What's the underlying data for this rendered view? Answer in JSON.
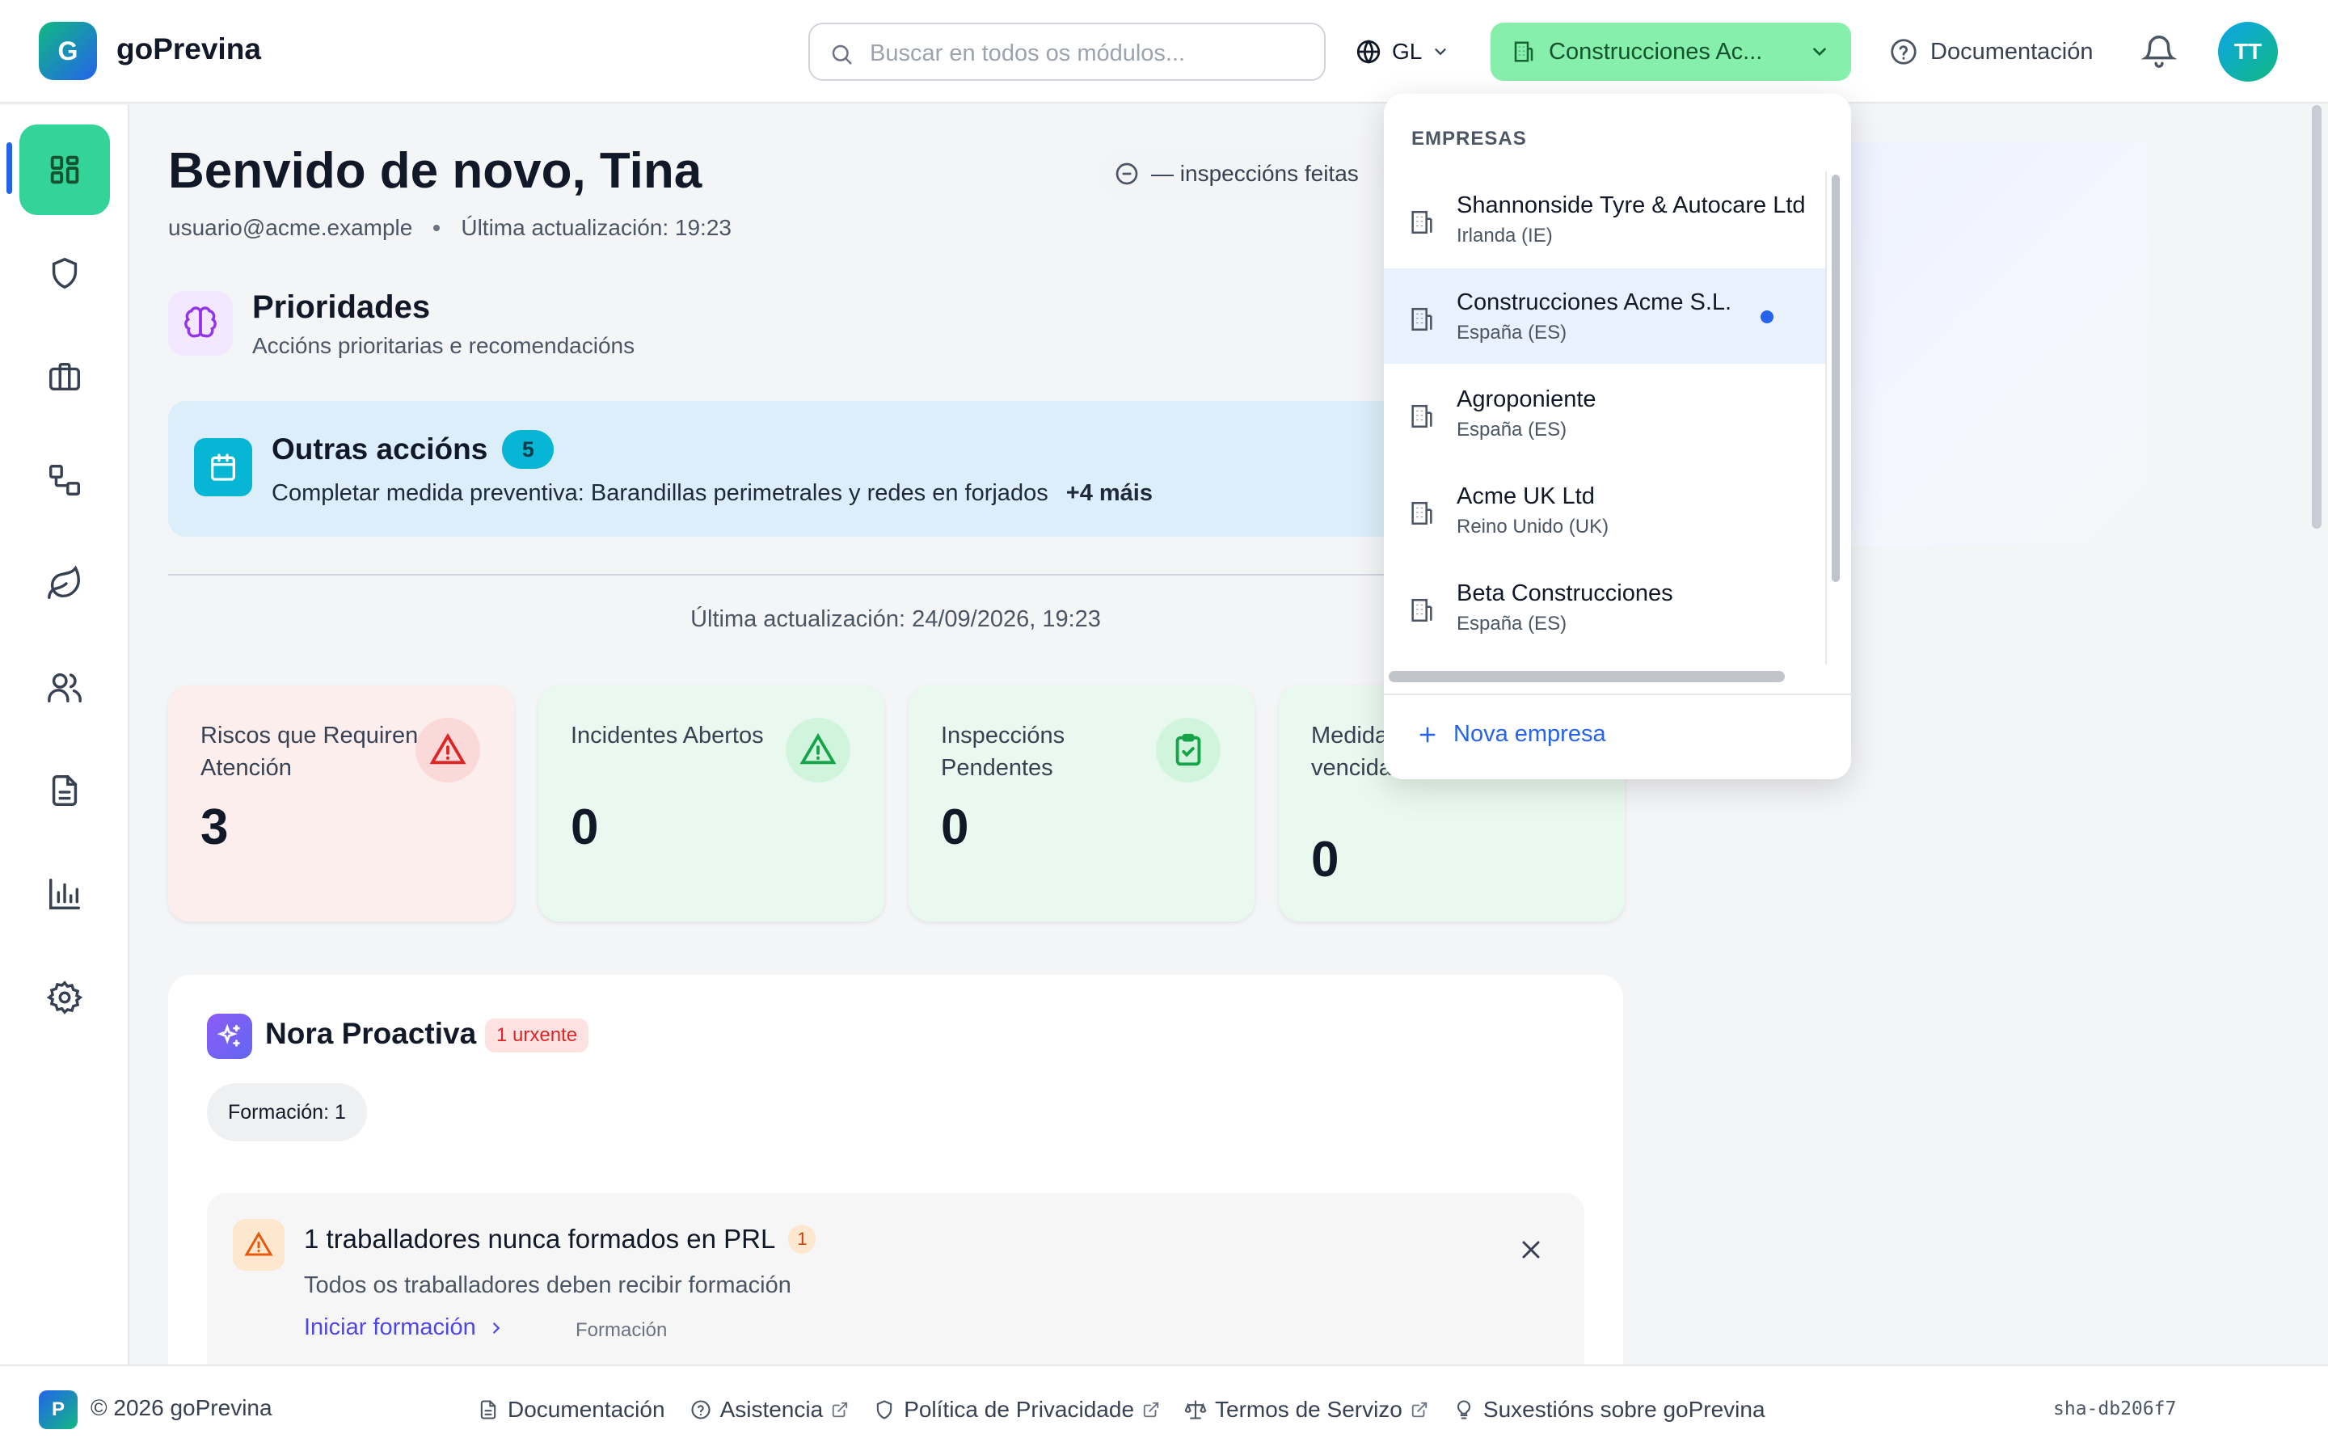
{
  "header": {
    "app_name": "goPrevina",
    "logo_letter": "G",
    "search_placeholder": "Buscar en todos os módulos...",
    "language": "GL",
    "company_selected": "Construcciones Ac...",
    "docs_label": "Documentación",
    "avatar_initials": "TT"
  },
  "sidebar": {
    "items": [
      {
        "icon": "dashboard-icon",
        "active": true
      },
      {
        "icon": "shield-icon"
      },
      {
        "icon": "briefcase-icon"
      },
      {
        "icon": "workflow-icon"
      },
      {
        "icon": "leaf-icon"
      },
      {
        "icon": "users-icon"
      },
      {
        "icon": "document-icon"
      },
      {
        "icon": "bar-chart-icon"
      },
      {
        "icon": "settings-icon"
      }
    ]
  },
  "main": {
    "welcome": "Benvido de novo, Tina",
    "email": "usuario@acme.example",
    "last_update_short": "Última actualización: 19:23",
    "inspections_pill": "— inspeccións feitas",
    "priorities_title": "Prioridades",
    "priorities_subtitle": "Accións prioritarias e recomendacións",
    "other_actions": {
      "title": "Outras accións",
      "count": "5",
      "description": "Completar medida preventiva: Barandillas perimetrales y redes en forjados",
      "more": "+4 máis"
    },
    "last_update_full": "Última actualización: 24/09/2026, 19:23",
    "stats": [
      {
        "label": "Riscos que Requiren Atención",
        "value": "3"
      },
      {
        "label": "Incidentes Abertos",
        "value": "0"
      },
      {
        "label": "Inspeccións Pendentes",
        "value": "0"
      },
      {
        "label": "Medidas preventivas vencidas",
        "value": "0"
      }
    ],
    "nora": {
      "title": "Nora Proactiva",
      "urgent_badge": "1 urxente",
      "chip": "Formación: 1",
      "alert": {
        "title": "1 traballadores nunca formados en PRL",
        "count": "1",
        "description": "Todos os traballadores deben recibir formación",
        "link": "Iniciar formación",
        "tag": "Formación"
      }
    }
  },
  "dropdown": {
    "heading": "EMPRESAS",
    "companies": [
      {
        "name": "Shannonside Tyre & Autocare Ltd",
        "country": "Irlanda (IE)"
      },
      {
        "name": "Construcciones Acme S.L.",
        "country": "España (ES)",
        "selected": true
      },
      {
        "name": "Agroponiente",
        "country": "España (ES)"
      },
      {
        "name": "Acme UK Ltd",
        "country": "Reino Unido (UK)"
      },
      {
        "name": "Beta Construcciones",
        "country": "España (ES)"
      }
    ],
    "new_company": "Nova empresa"
  },
  "footer": {
    "logo_letter": "P",
    "copyright": "© 2026 goPrevina",
    "links": [
      "Documentación",
      "Asistencia",
      "Política de Privacidade",
      "Termos de Servizo",
      "Suxestións sobre goPrevina"
    ],
    "sha": "sha-db206f7"
  }
}
